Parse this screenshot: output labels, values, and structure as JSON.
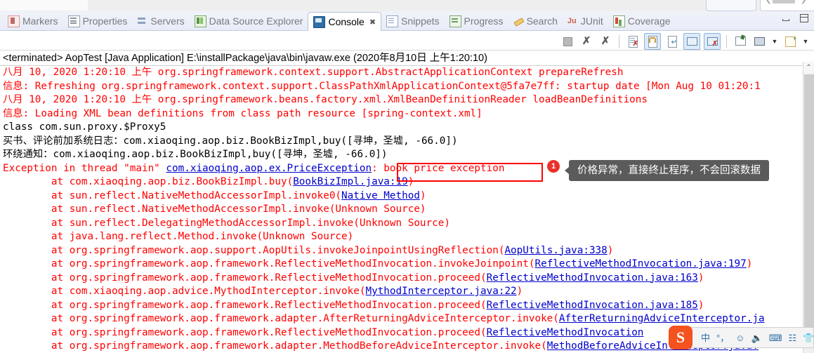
{
  "window": {
    "minimize_label": "minimize",
    "maximize_label": "maximize"
  },
  "tabbar": {
    "tabs": [
      {
        "label": "Markers",
        "icon": "markers-icon",
        "active": false
      },
      {
        "label": "Properties",
        "icon": "properties-icon",
        "active": false
      },
      {
        "label": "Servers",
        "icon": "servers-icon",
        "active": false
      },
      {
        "label": "Data Source Explorer",
        "icon": "database-icon",
        "active": false
      },
      {
        "label": "Console",
        "icon": "console-icon",
        "active": true,
        "close": "✖"
      },
      {
        "label": "Snippets",
        "icon": "snippets-icon",
        "active": false
      },
      {
        "label": "Progress",
        "icon": "progress-icon",
        "active": false
      },
      {
        "label": "Search",
        "icon": "search-icon",
        "active": false
      },
      {
        "label": "JUnit",
        "icon": "junit-icon",
        "active": false
      },
      {
        "label": "Coverage",
        "icon": "coverage-icon",
        "active": false
      }
    ]
  },
  "toolbar": {
    "buttons": [
      {
        "name": "terminate-button",
        "icon": "stop-icon",
        "selected": false
      },
      {
        "name": "remove-launch-button",
        "icon": "cross-icon",
        "selected": false
      },
      {
        "name": "remove-all-launches-button",
        "icon": "double-cross-icon",
        "selected": false
      },
      {
        "name": "clear-console-button",
        "icon": "clear-console-icon",
        "selected": false
      },
      {
        "name": "scroll-lock-button",
        "icon": "lock-icon",
        "selected": true
      },
      {
        "name": "word-wrap-button",
        "icon": "word-wrap-icon",
        "selected": false
      },
      {
        "name": "show-console-on-output-button",
        "icon": "console-out-icon",
        "selected": true
      },
      {
        "name": "show-console-on-error-button",
        "icon": "console-err-icon",
        "selected": true
      },
      {
        "name": "pin-console-button",
        "icon": "pin-icon",
        "selected": false
      },
      {
        "name": "display-selected-console-button",
        "icon": "monitor-icon",
        "selected": false
      },
      {
        "name": "display-console-dropdown",
        "icon": "chevron-down-icon",
        "selected": false
      },
      {
        "name": "open-console-button",
        "icon": "new-console-icon",
        "selected": false
      },
      {
        "name": "open-console-dropdown",
        "icon": "chevron-down-icon",
        "selected": false
      }
    ]
  },
  "launch": {
    "header": "<terminated> AopTest [Java Application] E:\\installPackage\\java\\bin\\javaw.exe (2020年8月10日 上午1:20:10)"
  },
  "console": {
    "lines": [
      {
        "color": "red",
        "text": "八月 10, 2020 1:20:10 上午 org.springframework.context.support.AbstractApplicationContext prepareRefresh"
      },
      {
        "color": "red",
        "text": "信息: Refreshing org.springframework.context.support.ClassPathXmlApplicationContext@5fa7e7ff: startup date [Mon Aug 10 01:20:1"
      },
      {
        "color": "red",
        "text": "八月 10, 2020 1:20:10 上午 org.springframework.beans.factory.xml.XmlBeanDefinitionReader loadBeanDefinitions"
      },
      {
        "color": "red",
        "text": "信息: Loading XML bean definitions from class path resource [spring-context.xml]"
      },
      {
        "color": "black",
        "text": "class com.sun.proxy.$Proxy5"
      },
      {
        "color": "black",
        "text": "买书、评论前加系统日志：com.xiaoqing.aop.biz.BookBizImpl,buy([寻坤，圣墟, -66.0])"
      },
      {
        "color": "black",
        "text": "环绕通知：com.xiaoqing.aop.biz.BookBizImpl,buy([寻坤，圣墟, -66.0])"
      },
      {
        "color": "red",
        "segments": [
          {
            "t": "Exception in thread \"main\" ",
            "k": "red"
          },
          {
            "t": "com.xiaoqing.aop.ex.PriceException",
            "k": "link"
          },
          {
            "t": ": book price exception",
            "k": "red"
          }
        ]
      },
      {
        "color": "red",
        "segments": [
          {
            "t": "\tat com.xiaoqing.aop.biz.BookBizImpl.buy(",
            "k": "red"
          },
          {
            "t": "BookBizImpl.java:19",
            "k": "link"
          },
          {
            "t": ")",
            "k": "red"
          }
        ]
      },
      {
        "color": "red",
        "segments": [
          {
            "t": "\tat sun.reflect.NativeMethodAccessorImpl.invoke0(",
            "k": "red"
          },
          {
            "t": "Native Method",
            "k": "link"
          },
          {
            "t": ")",
            "k": "red"
          }
        ]
      },
      {
        "color": "red",
        "text": "\tat sun.reflect.NativeMethodAccessorImpl.invoke(Unknown Source)"
      },
      {
        "color": "red",
        "text": "\tat sun.reflect.DelegatingMethodAccessorImpl.invoke(Unknown Source)"
      },
      {
        "color": "red",
        "text": "\tat java.lang.reflect.Method.invoke(Unknown Source)"
      },
      {
        "color": "red",
        "segments": [
          {
            "t": "\tat org.springframework.aop.support.AopUtils.invokeJoinpointUsingReflection(",
            "k": "red"
          },
          {
            "t": "AopUtils.java:338",
            "k": "link"
          },
          {
            "t": ")",
            "k": "red"
          }
        ]
      },
      {
        "color": "red",
        "segments": [
          {
            "t": "\tat org.springframework.aop.framework.ReflectiveMethodInvocation.invokeJoinpoint(",
            "k": "red"
          },
          {
            "t": "ReflectiveMethodInvocation.java:197",
            "k": "link"
          },
          {
            "t": ")",
            "k": "red"
          }
        ]
      },
      {
        "color": "red",
        "segments": [
          {
            "t": "\tat org.springframework.aop.framework.ReflectiveMethodInvocation.proceed(",
            "k": "red"
          },
          {
            "t": "ReflectiveMethodInvocation.java:163",
            "k": "link"
          },
          {
            "t": ")",
            "k": "red"
          }
        ]
      },
      {
        "color": "red",
        "segments": [
          {
            "t": "\tat com.xiaoqing.aop.advice.MythodInterceptor.invoke(",
            "k": "red"
          },
          {
            "t": "MythodInterceptor.java:22",
            "k": "link"
          },
          {
            "t": ")",
            "k": "red"
          }
        ]
      },
      {
        "color": "red",
        "segments": [
          {
            "t": "\tat org.springframework.aop.framework.ReflectiveMethodInvocation.proceed(",
            "k": "red"
          },
          {
            "t": "ReflectiveMethodInvocation.java:185",
            "k": "link"
          },
          {
            "t": ")",
            "k": "red"
          }
        ]
      },
      {
        "color": "red",
        "segments": [
          {
            "t": "\tat org.springframework.aop.framework.adapter.AfterReturningAdviceInterceptor.invoke(",
            "k": "red"
          },
          {
            "t": "AfterReturningAdviceInterceptor.ja",
            "k": "link"
          }
        ]
      },
      {
        "color": "red",
        "segments": [
          {
            "t": "\tat org.springframework.aop.framework.ReflectiveMethodInvocation.proceed(",
            "k": "red"
          },
          {
            "t": "ReflectiveMethodInvocation",
            "k": "link"
          }
        ]
      },
      {
        "color": "red",
        "segments": [
          {
            "t": "\tat org.springframework.aop.framework.adapter.MethodBeforeAdviceInterceptor.invoke(",
            "k": "red"
          },
          {
            "t": "MethodBeforeAdviceInterceptor.java:",
            "k": "link"
          }
        ]
      }
    ]
  },
  "annotation": {
    "badge": "1",
    "tooltip": "价格异常，直接终止程序，不会回滚数据",
    "highlight_text": "book price exception",
    "box_color": "#ff0000",
    "badge_color": "#e8322b",
    "tooltip_bg": "#5b5b5b"
  },
  "ime": {
    "logo": "S",
    "items": [
      "中",
      "°，",
      "☺",
      "🎙",
      "⌨",
      "📇",
      "👕"
    ],
    "grid_icon": "apps-grid-icon"
  },
  "scrollbar": {
    "up_arrow": "⌃"
  }
}
